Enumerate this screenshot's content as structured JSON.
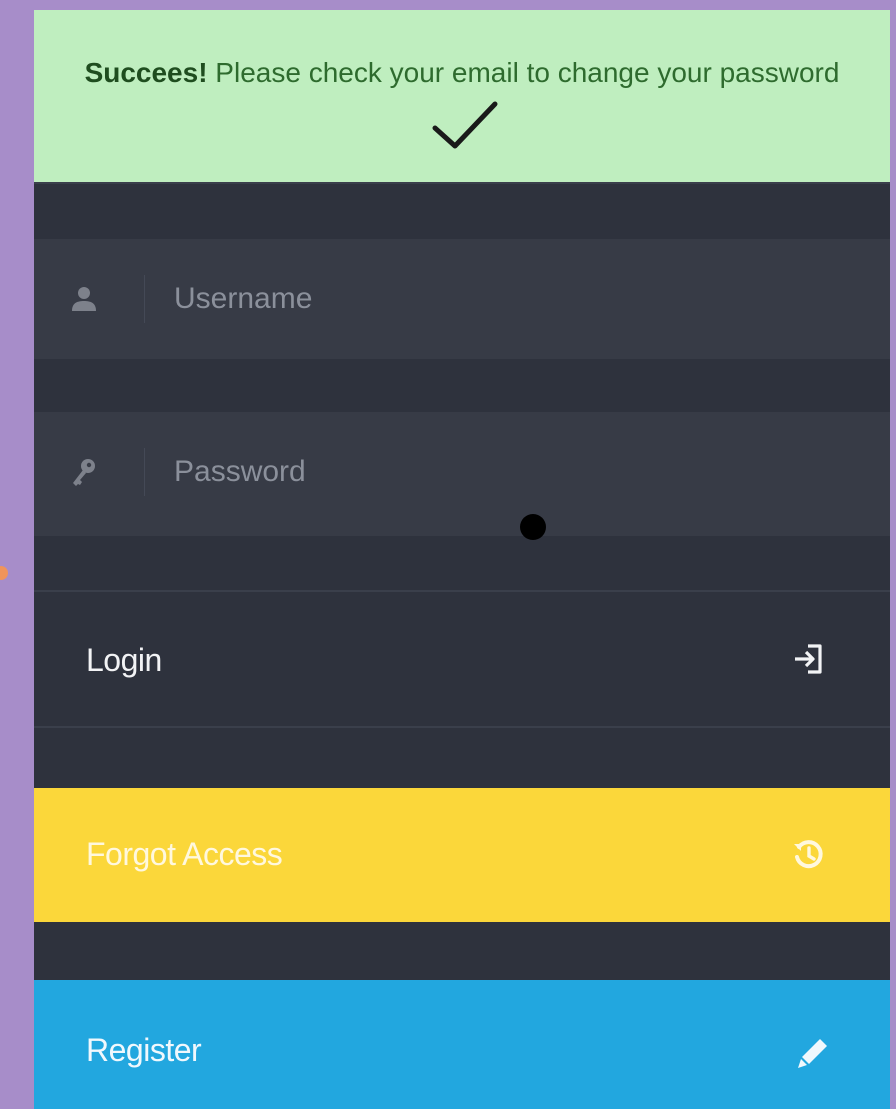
{
  "alert": {
    "strong": "Succees!",
    "message": " Please check your email to change your password",
    "color_bg": "#bfeebf"
  },
  "form": {
    "username": {
      "placeholder": "Username",
      "icon": "user-icon"
    },
    "password": {
      "placeholder": "Password",
      "icon": "key-icon"
    }
  },
  "buttons": {
    "login": {
      "label": "Login",
      "icon": "sign-in-icon",
      "color": "#2e323d"
    },
    "forgot": {
      "label": "Forgot Access",
      "icon": "history-icon",
      "color": "#fbd73a"
    },
    "register": {
      "label": "Register",
      "icon": "pencil-icon",
      "color": "#22a7df"
    }
  }
}
